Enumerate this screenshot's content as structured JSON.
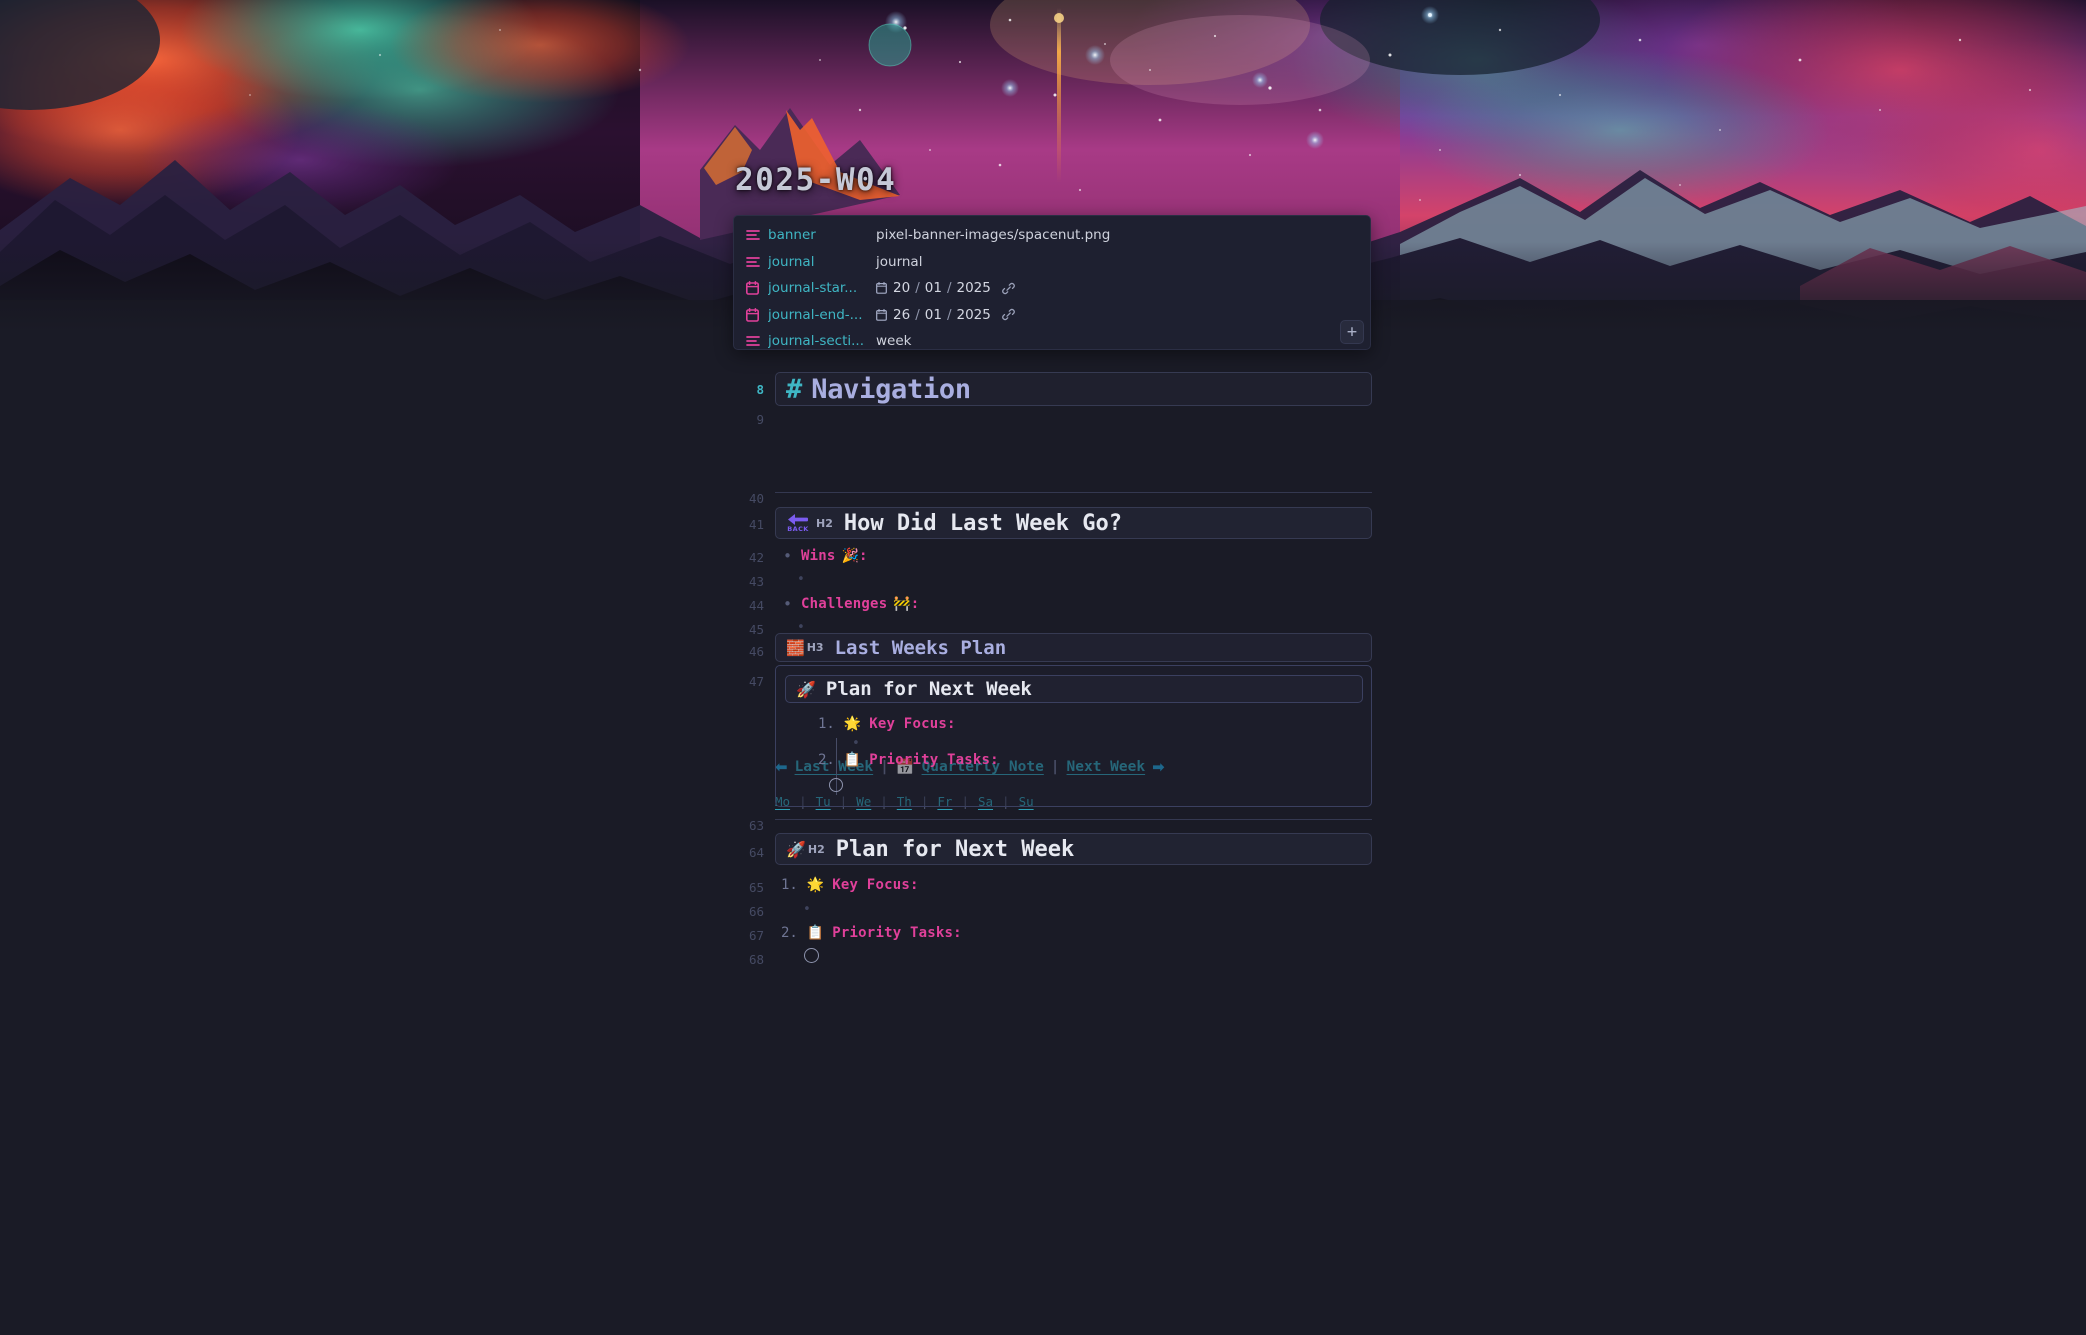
{
  "window": {
    "app": "obsidian",
    "theme": "dark"
  },
  "banner": {
    "title": "2025-W04",
    "image_name": "spacenut.png",
    "alt": "cosmic nebula over silhouetted mountain range"
  },
  "properties": {
    "add_button_label": "+",
    "rows": [
      {
        "icon": "text-lines-icon",
        "key": "banner",
        "type": "text",
        "value": "pixel-banner-images/spacenut.png"
      },
      {
        "icon": "text-lines-icon",
        "key": "journal",
        "type": "text",
        "value": "journal"
      },
      {
        "icon": "calendar-icon",
        "key": "journal-star...",
        "type": "date",
        "day": "20",
        "month": "01",
        "year": "2025",
        "sep": "/"
      },
      {
        "icon": "calendar-icon",
        "key": "journal-end-...",
        "type": "date",
        "day": "26",
        "month": "01",
        "year": "2025",
        "sep": "/"
      },
      {
        "icon": "text-lines-icon",
        "key": "journal-secti...",
        "type": "text",
        "value": "week"
      }
    ]
  },
  "editor": {
    "line_numbers": {
      "nav_heading": "8",
      "nav_links": "9",
      "hr_top": "40",
      "h2_last_week": "41",
      "wins": "42",
      "wins_child": "43",
      "challenges": "44",
      "challenges_child": "45",
      "h3_last_weeks_plan": "46",
      "embed": "47",
      "hr_bottom": "63",
      "h2_plan": "64",
      "key_focus": "65",
      "key_focus_child": "66",
      "priority_tasks": "67",
      "priority_checkbox": "68"
    },
    "nav_heading": {
      "hash": "#",
      "text": "Navigation"
    },
    "nav_links": {
      "back_icon": "⬅",
      "last_week": "Last Week",
      "sep1": "|",
      "calendar_icon": "📅",
      "quarterly_note": "Quarterly Note",
      "sep2": "|",
      "next_week": "Next Week",
      "forward_icon": "➡"
    },
    "weekdays": [
      "Mo",
      "Tu",
      "We",
      "Th",
      "Fr",
      "Sa",
      "Su"
    ],
    "weekday_sep": "|",
    "h2_last_week": {
      "emoji": "⬅",
      "emoji_caption": "BACK",
      "badge": "H2",
      "text": "How Did Last Week Go?"
    },
    "wins": {
      "label": "Wins",
      "emoji": "🎉",
      "colon": ":"
    },
    "challenges": {
      "label": "Challenges",
      "emoji": "🚧",
      "colon": ":"
    },
    "h3_last_weeks_plan": {
      "emoji": "🧱",
      "badge": "H3",
      "text": "Last Weeks Plan"
    },
    "embed": {
      "title_emoji": "🚀",
      "title": "Plan for Next Week",
      "items": [
        {
          "index": "1.",
          "emoji": "🌟",
          "label": "Key Focus",
          "colon": ":"
        },
        {
          "index": "2.",
          "emoji": "📋",
          "label": "Priority Tasks",
          "colon": ":"
        }
      ]
    },
    "h2_plan": {
      "emoji": "🚀",
      "badge": "H2",
      "text": "Plan for Next Week"
    },
    "plan_items": [
      {
        "index": "1.",
        "emoji": "🌟",
        "label": "Key Focus",
        "colon": ":"
      },
      {
        "index": "2.",
        "emoji": "📋",
        "label": "Priority Tasks",
        "colon": ":"
      }
    ]
  },
  "colors": {
    "background": "#1a1b26",
    "panel": "#1e2030",
    "accent_teal": "#3fb6c4",
    "accent_pink": "#e0409a",
    "heading_lavender": "#a9aee0",
    "text": "#cfd2dd",
    "line_number": "#454a63"
  }
}
